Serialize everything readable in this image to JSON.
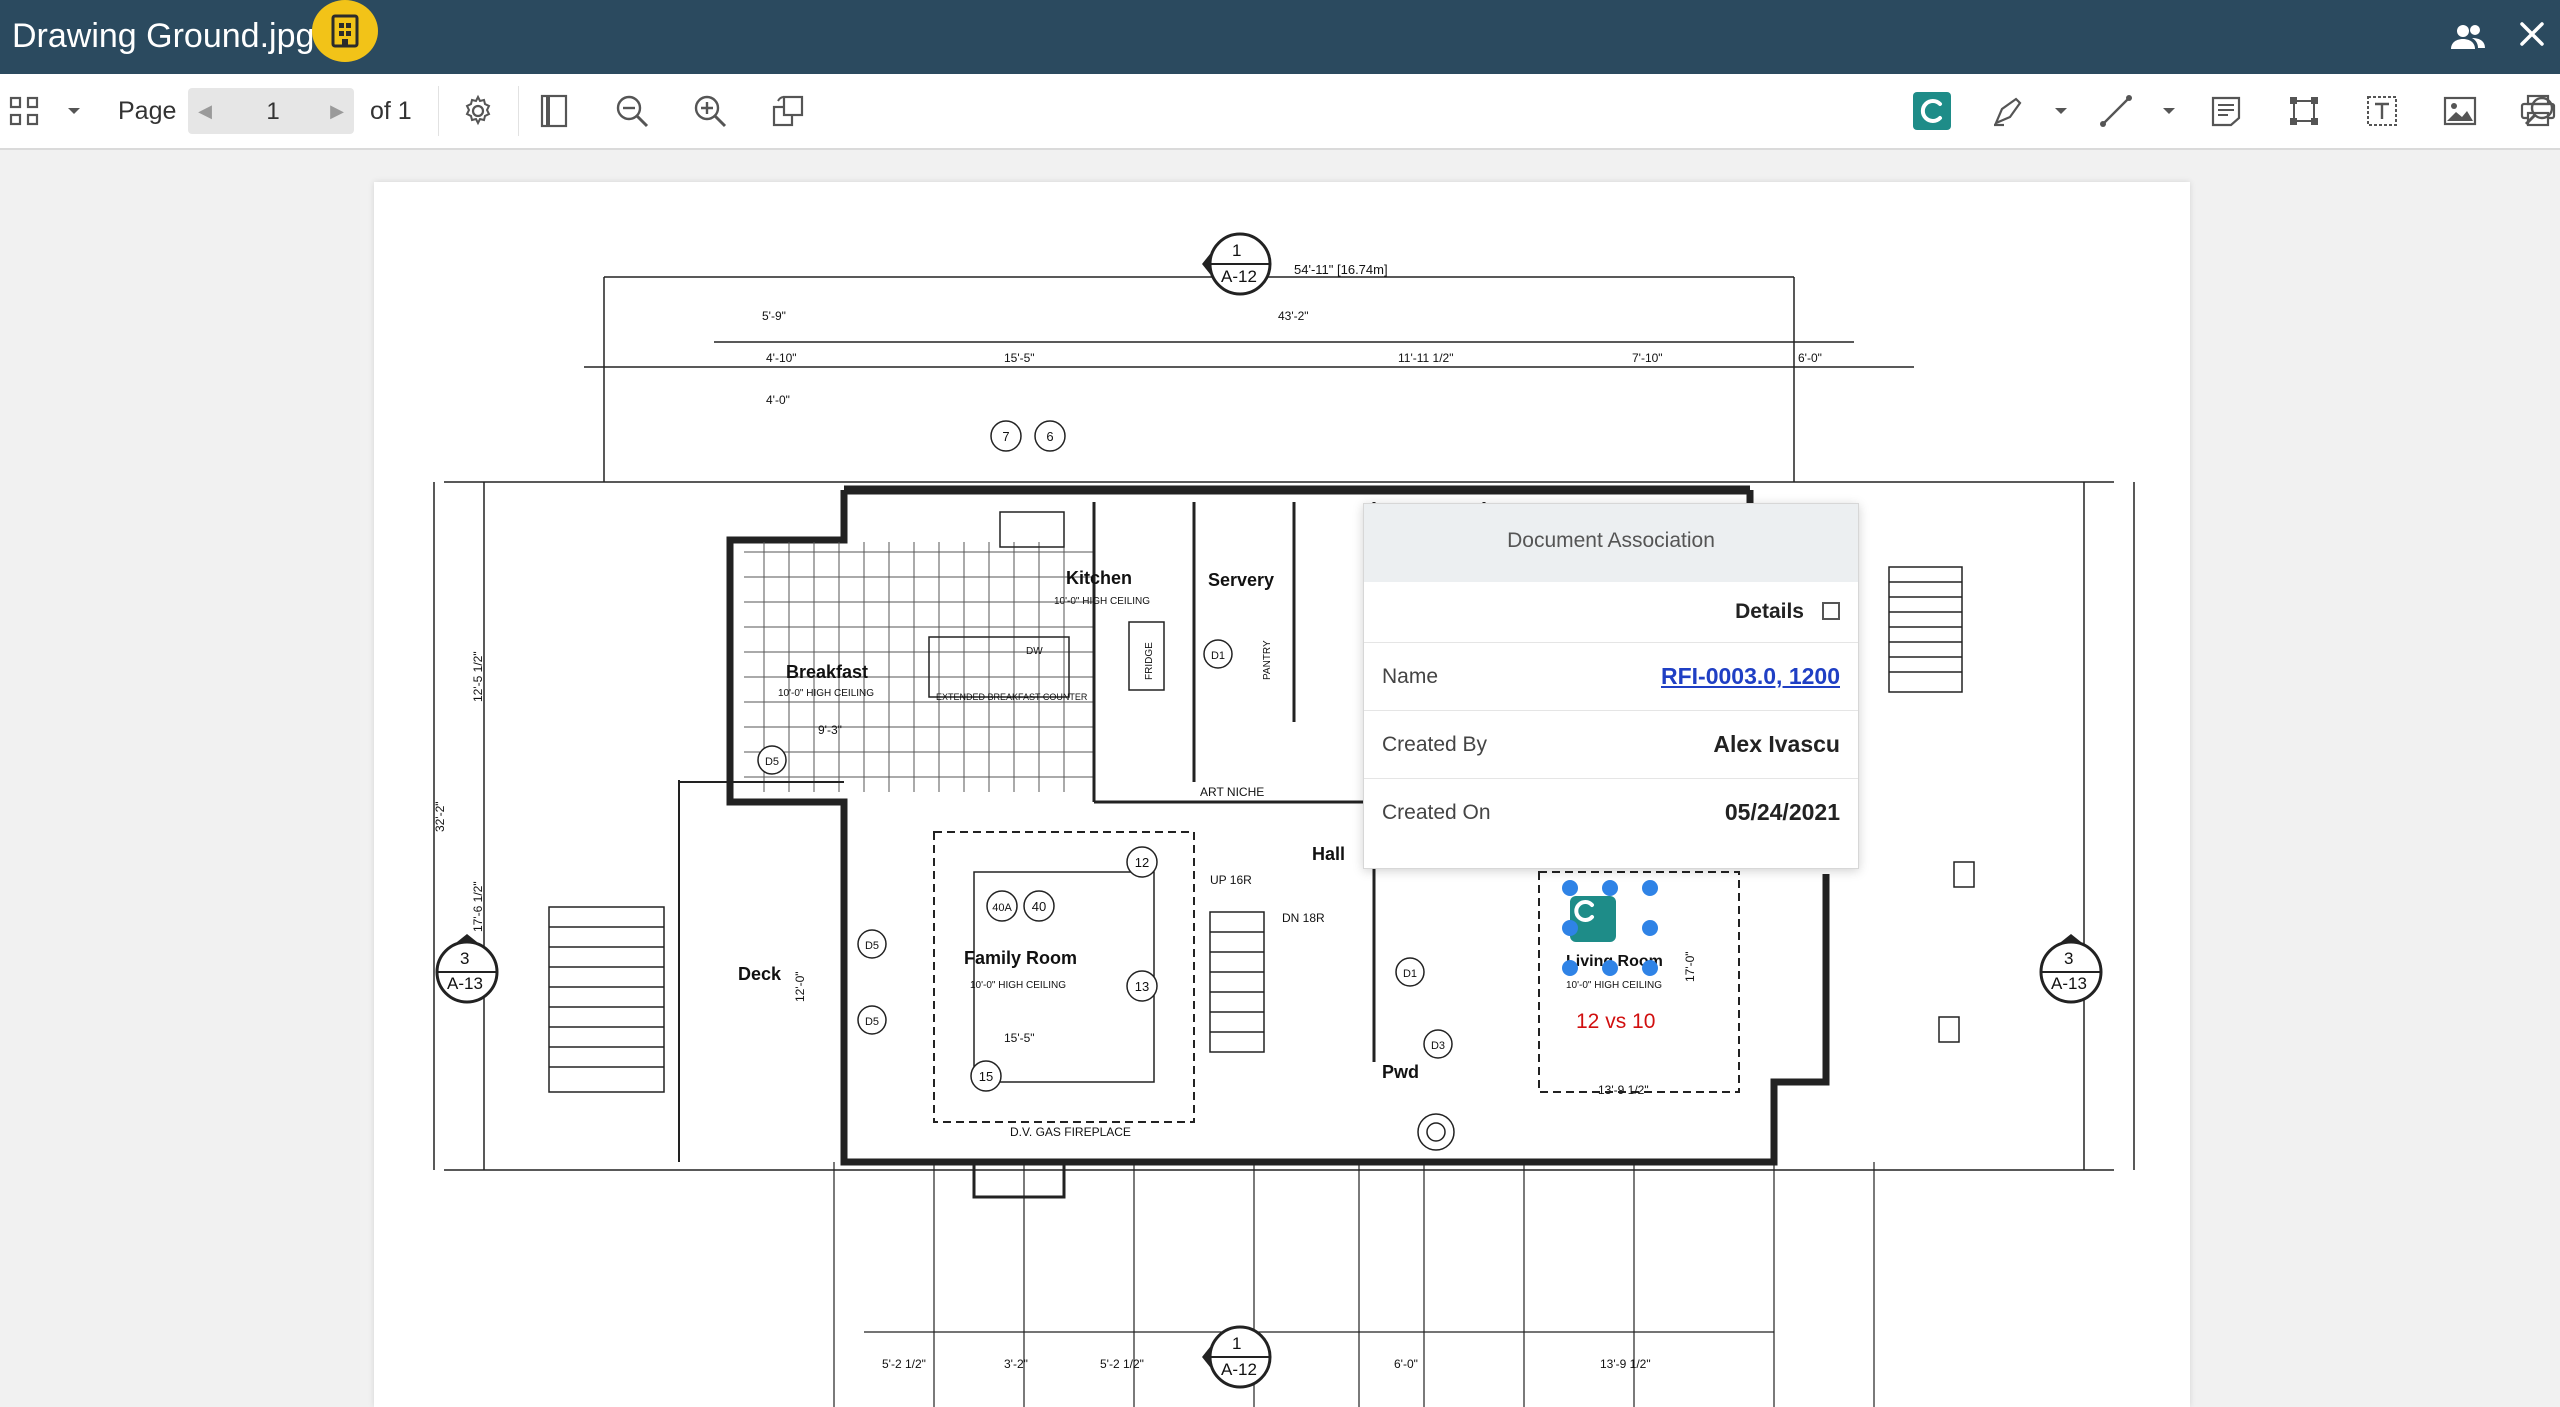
{
  "window": {
    "title": "Drawing Ground.jpg"
  },
  "toolbar": {
    "page_label": "Page",
    "page_value": "1",
    "of_label": "of 1"
  },
  "popup": {
    "header": "Document Association",
    "details_label": "Details",
    "rows": [
      {
        "key": "Name",
        "value": "RFI-0003.0, 1200"
      },
      {
        "key": "Created By",
        "value": "Alex Ivascu"
      },
      {
        "key": "Created On",
        "value": "05/24/2021"
      }
    ]
  },
  "drawing": {
    "rooms": [
      {
        "name": "Kitchen",
        "note": "10'-0\" HIGH CEILING"
      },
      {
        "name": "Servery"
      },
      {
        "name": "Breakfast",
        "note": "10'-0\" HIGH CEILING"
      },
      {
        "name": "Hall"
      },
      {
        "name": "Family Room",
        "note": "10'-0\" HIGH CEILING"
      },
      {
        "name": "Deck"
      },
      {
        "name": "Pwd"
      },
      {
        "name": "Living Room",
        "note": "10'-0\" HIGH CEILING"
      }
    ],
    "labels": {
      "art_niche": "ART NICHE",
      "fireplace": "D.V. GAS FIREPLACE",
      "counter": "EXTENDED BREAKFAST COUNTER",
      "up": "UP 16R",
      "dn": "DN 18R",
      "fridge": "FRIDGE",
      "pantry": "PANTRY",
      "dw": "DW"
    },
    "section_marks": [
      {
        "num": "1",
        "sheet": "A-12"
      },
      {
        "num": "3",
        "sheet": "A-13"
      },
      {
        "num": "3",
        "sheet": "A-13"
      },
      {
        "num": "1",
        "sheet": "A-12"
      }
    ],
    "dimensions": [
      "54'-11\" [16.74m]",
      "43'-2\"",
      "15'-5\"",
      "11'-11 1/2\"",
      "7'-10\"",
      "6'-0\"",
      "4'-10\"",
      "5'-9\"",
      "4'-0\"",
      "15'-5\"",
      "13'-9 1/2\"",
      "9'-3\"",
      "32'-2\"",
      "12'-5 1/2\"",
      "17'-6 1/2\"",
      "12'-0\"",
      "17'-0\"",
      "5'-2 1/2\"",
      "3'-2\"",
      "5'-2 1/2\"",
      "6'-0\"",
      "13'-9 1/2\""
    ],
    "tags": [
      "7",
      "6",
      "12",
      "13",
      "15",
      "40A",
      "40",
      "D5",
      "D5",
      "D5",
      "D1",
      "D1",
      "D3"
    ],
    "annotation": "12 vs 10"
  },
  "colors": {
    "titlebar": "#2b4a5f",
    "badge": "#f2c318",
    "link": "#1f3fc4",
    "annotation": "#d10f0f",
    "selection": "#2f83e6",
    "brand": "#1e8c88"
  }
}
